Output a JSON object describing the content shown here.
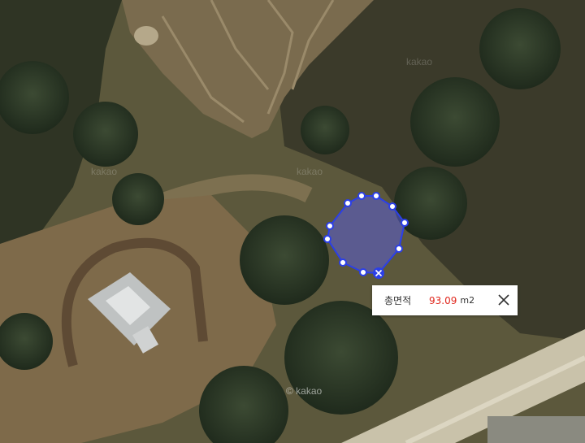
{
  "map": {
    "watermark": "© kakao",
    "watermark_ghost": "kakao"
  },
  "measure": {
    "label": "총면적",
    "value": "93.09",
    "unit": "m2",
    "polygon_fill": "#5b5fd6",
    "line_color": "#2b3fe8"
  }
}
